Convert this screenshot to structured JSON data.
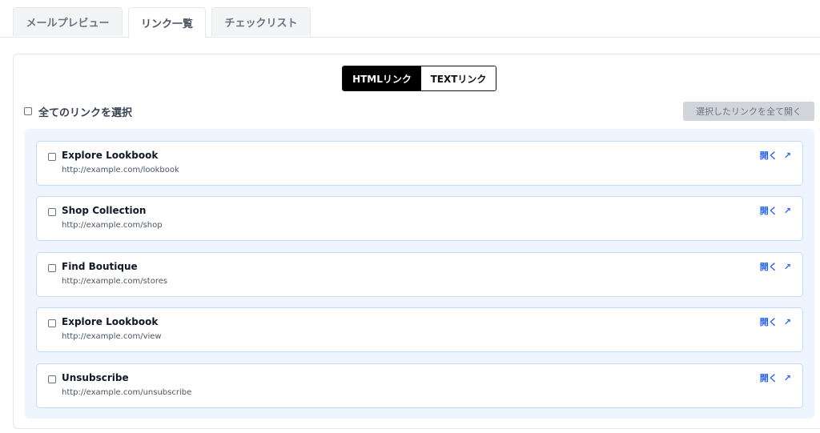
{
  "tabs": [
    {
      "label": "メールプレビュー",
      "active": false
    },
    {
      "label": "リンク一覧",
      "active": true
    },
    {
      "label": "チェックリスト",
      "active": false
    }
  ],
  "toggle": {
    "html_label": "HTMLリンク",
    "text_label": "TEXTリンク",
    "selected": "HTMLリンク"
  },
  "select_all_label": "全てのリンクを選択",
  "open_selected_label": "選択したリンクを全て開く",
  "open_label": "開く",
  "links": [
    {
      "title": "Explore Lookbook",
      "url": "http://example.com/lookbook"
    },
    {
      "title": "Shop Collection",
      "url": "http://example.com/shop"
    },
    {
      "title": "Find Boutique",
      "url": "http://example.com/stores"
    },
    {
      "title": "Explore Lookbook",
      "url": "http://example.com/view"
    },
    {
      "title": "Unsubscribe",
      "url": "http://example.com/unsubscribe"
    }
  ],
  "colors": {
    "accent": "#2563eb",
    "card_border": "#bfdbfe",
    "list_bg": "#eef5ff",
    "toggle_active": "#000000"
  }
}
